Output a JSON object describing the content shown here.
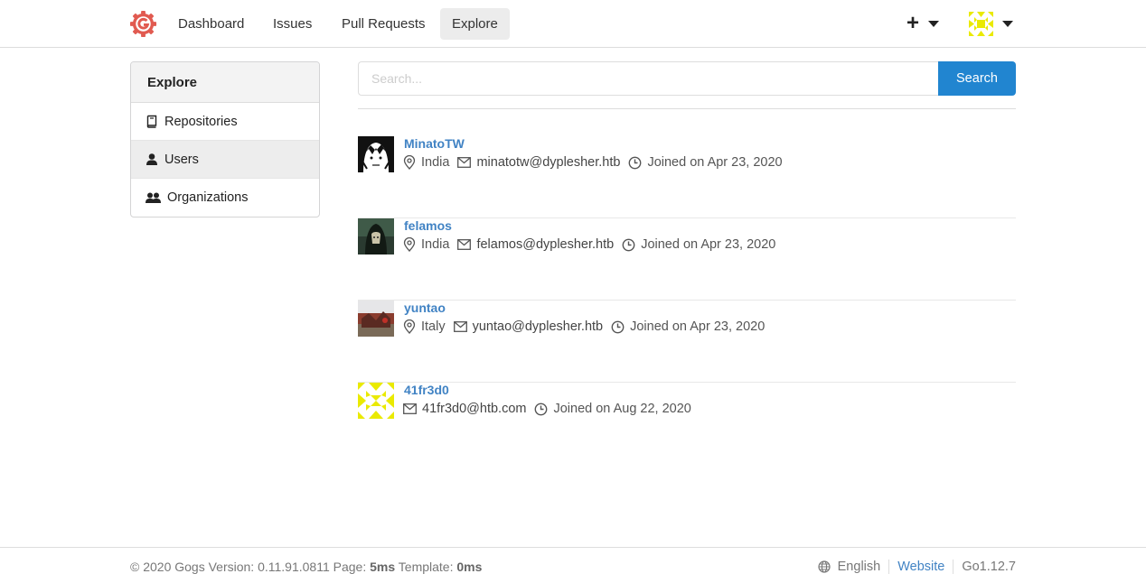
{
  "nav": {
    "items": [
      {
        "label": "Dashboard"
      },
      {
        "label": "Issues"
      },
      {
        "label": "Pull Requests"
      },
      {
        "label": "Explore"
      }
    ],
    "create_icon": "plus-icon",
    "avatar_icon": "identicon-yellow"
  },
  "sidebar": {
    "title": "Explore",
    "items": [
      {
        "label": "Repositories",
        "icon": "repo-book-icon"
      },
      {
        "label": "Users",
        "icon": "user-icon"
      },
      {
        "label": "Organizations",
        "icon": "organization-icon"
      }
    ]
  },
  "search": {
    "placeholder": "Search...",
    "button_label": "Search"
  },
  "users": [
    {
      "name": "MinatoTW",
      "location": "India",
      "email": "minatotw@dyplesher.htb",
      "joined": "Joined on Apr 23, 2020"
    },
    {
      "name": "felamos",
      "location": "India",
      "email": "felamos@dyplesher.htb",
      "joined": "Joined on Apr 23, 2020"
    },
    {
      "name": "yuntao",
      "location": "Italy",
      "email": "yuntao@dyplesher.htb",
      "joined": "Joined on Apr 23, 2020"
    },
    {
      "name": "41fr3d0",
      "location": "",
      "email": "41fr3d0@htb.com",
      "joined": "Joined on Aug 22, 2020"
    }
  ],
  "footer": {
    "copyright": "© 2020 Gogs Version: 0.11.91.0811 Page:",
    "page_time": "5ms",
    "template_label": "Template:",
    "template_time": "0ms",
    "language": "English",
    "website": "Website",
    "go_version": "Go1.12.7"
  },
  "colors": {
    "primary": "#2185d0",
    "link": "#4183c4",
    "logo": "#e15a50",
    "identicon": "#f0f000"
  }
}
